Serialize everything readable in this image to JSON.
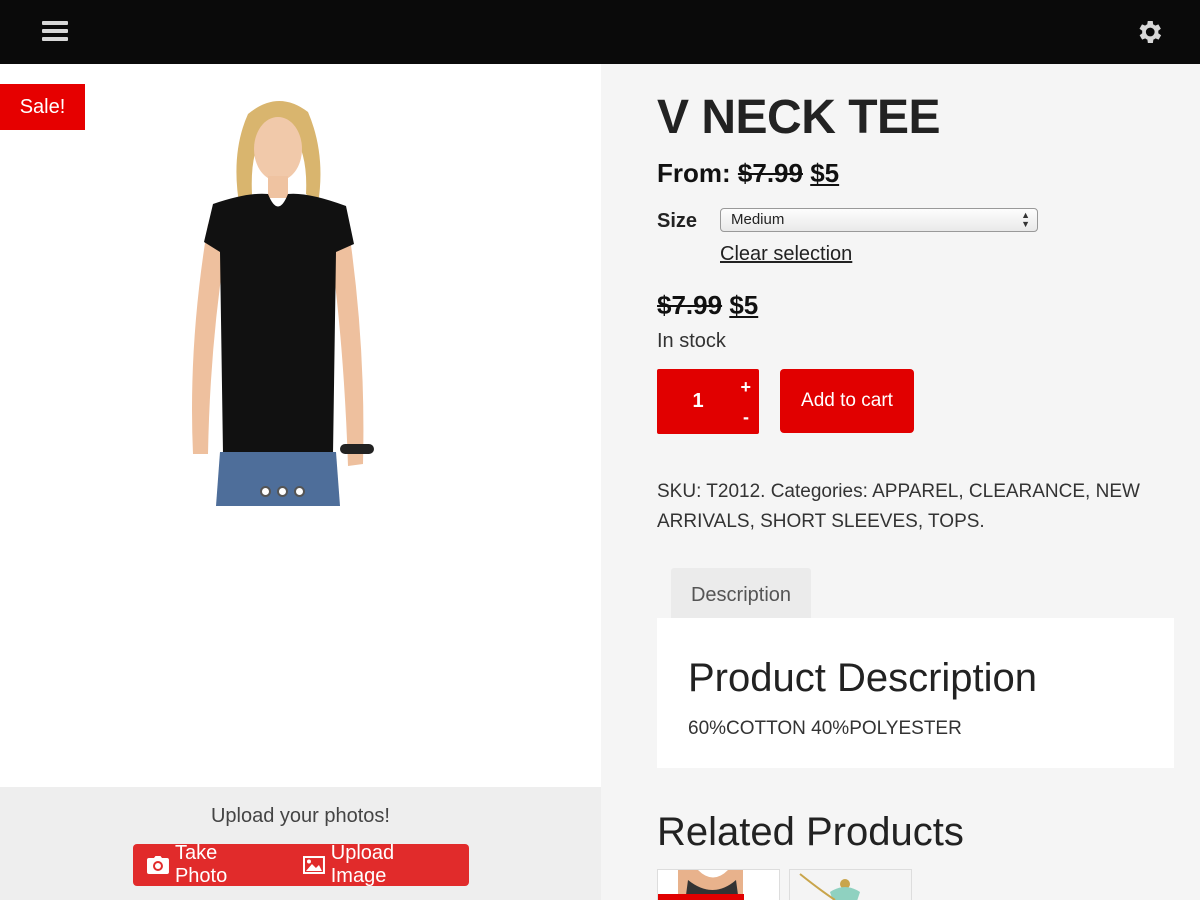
{
  "header": {
    "menu_icon": "hamburger-menu-icon",
    "settings_icon": "gear-icon"
  },
  "product": {
    "badge": "Sale!",
    "title": "V NECK TEE",
    "from_label": "From:",
    "old_price": "$7.99",
    "new_price": "$5",
    "size_label": "Size",
    "size_selected": "Medium",
    "clear_selection": "Clear selection",
    "variation_old_price": "$7.99",
    "variation_new_price": "$5",
    "stock_status": "In stock",
    "quantity": "1",
    "qty_plus": "+",
    "qty_minus": "-",
    "add_to_cart": "Add to cart",
    "meta": "SKU: T2012. Categories: APPAREL, CLEARANCE, NEW ARRIVALS, SHORT SLEEVES, TOPS."
  },
  "tabs": {
    "description_tab": "Description"
  },
  "description": {
    "heading": "Product Description",
    "text": "60%COTTON 40%POLYESTER"
  },
  "related": {
    "title": "Related Products"
  },
  "upload": {
    "title": "Upload your photos!",
    "take_photo": "Take Photo",
    "upload_image": "Upload Image"
  },
  "colors": {
    "accent": "#e10000",
    "topbar": "#0a0a0a",
    "background": "#f5f5f5"
  }
}
